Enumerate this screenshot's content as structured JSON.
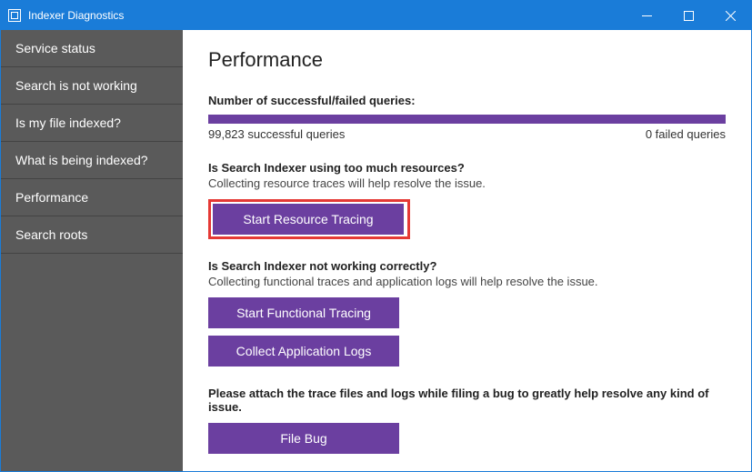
{
  "window": {
    "title": "Indexer Diagnostics"
  },
  "sidebar": {
    "items": [
      {
        "label": "Service status"
      },
      {
        "label": "Search is not working"
      },
      {
        "label": "Is my file indexed?"
      },
      {
        "label": "What is being indexed?"
      },
      {
        "label": "Performance"
      },
      {
        "label": "Search roots"
      }
    ]
  },
  "main": {
    "title": "Performance",
    "queries": {
      "heading": "Number of successful/failed queries:",
      "success_text": "99,823 successful queries",
      "failed_text": "0 failed queries"
    },
    "resource": {
      "heading": "Is Search Indexer using too much resources?",
      "sub": "Collecting resource traces will help resolve the issue.",
      "button": "Start Resource Tracing"
    },
    "functional": {
      "heading": "Is Search Indexer not working correctly?",
      "sub": "Collecting functional traces and application logs will help resolve the issue.",
      "trace_button": "Start Functional Tracing",
      "logs_button": "Collect Application Logs"
    },
    "attach": {
      "heading": "Please attach the trace files and logs while filing a bug to greatly help resolve any kind of issue.",
      "button": "File Bug"
    }
  },
  "colors": {
    "accent": "#6b3fa0",
    "titlebar": "#1a7cd8",
    "highlight": "#e53935"
  }
}
